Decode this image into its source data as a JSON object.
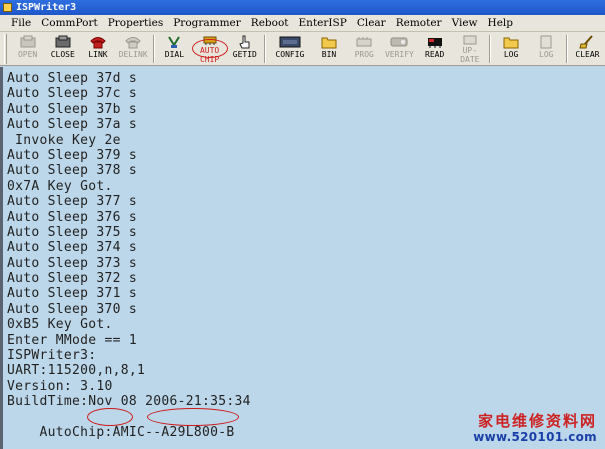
{
  "window": {
    "title": "ISPWriter3"
  },
  "menu": [
    "File",
    "CommPort",
    "Properties",
    "Programmer",
    "Reboot",
    "EnterISP",
    "Clear",
    "Remoter",
    "View",
    "Help"
  ],
  "toolbar": {
    "open": "OPEN",
    "close": "CLOSE",
    "link": "LINK",
    "delink": "DELINK",
    "dial": "DIAL",
    "autochip_1": "AUTO",
    "autochip_2": "CHIP",
    "getid": "GETID",
    "config": "CONFIG",
    "bin": "BIN",
    "prog": "PROG",
    "verify": "VERIFY",
    "read": "READ",
    "update_1": "UP-",
    "update_2": "DATE",
    "log": "LOG",
    "log2": "LOG",
    "clear": "CLEAR"
  },
  "console": {
    "lines": [
      "Auto Sleep 37d s",
      "Auto Sleep 37c s",
      "Auto Sleep 37b s",
      "Auto Sleep 37a s",
      " Invoke Key 2e",
      "Auto Sleep 379 s",
      "Auto Sleep 378 s",
      "0x7A Key Got.",
      "Auto Sleep 377 s",
      "Auto Sleep 376 s",
      "Auto Sleep 375 s",
      "Auto Sleep 374 s",
      "Auto Sleep 373 s",
      "Auto Sleep 372 s",
      "Auto Sleep 371 s",
      "Auto Sleep 370 s",
      "0xB5 Key Got.",
      "Enter MMode == 1",
      "ISPWriter3:",
      "UART:115200,n,8,1",
      "Version: 3.10",
      "BuildTime:Nov 08 2006-21:35:34",
      "AutoChip:AMIC--A29L800-B"
    ]
  },
  "watermark": {
    "chinese": "家电维修资料网",
    "url": "www.520101.com"
  }
}
